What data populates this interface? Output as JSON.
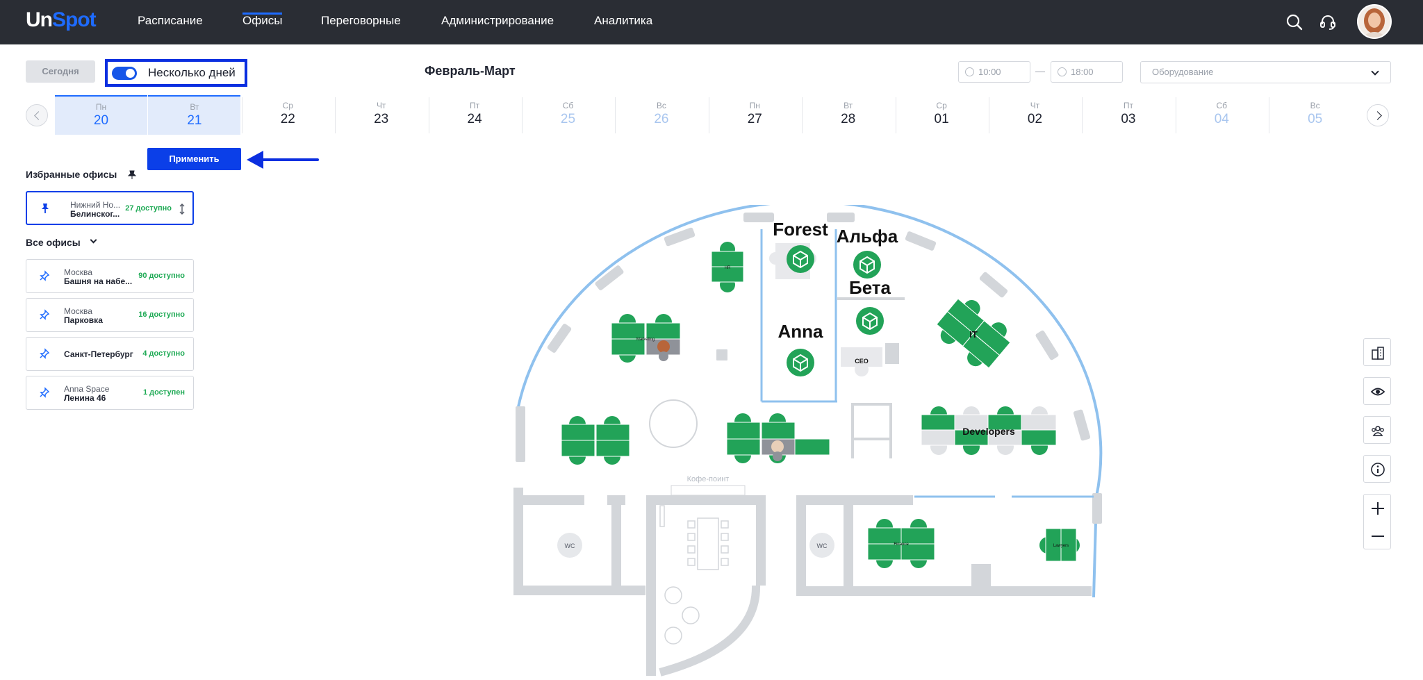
{
  "header": {
    "logo_un": "Un",
    "logo_spot": "Spot",
    "nav": [
      "Расписание",
      "Офисы",
      "Переговорные",
      "Администрирование",
      "Аналитика"
    ],
    "active_nav": "Офисы"
  },
  "toolbar": {
    "today_label": "Сегодня",
    "multi_days_label": "Несколько дней",
    "multi_days_enabled": true,
    "period_title": "Февраль-Март",
    "time_from": "10:00",
    "time_dash": "—",
    "time_to": "18:00",
    "equipment_placeholder": "Оборудование"
  },
  "calendar": {
    "days": [
      {
        "dow": "Пн",
        "num": "20",
        "selected": true,
        "weekend": false
      },
      {
        "dow": "Вт",
        "num": "21",
        "selected": true,
        "weekend": false
      },
      {
        "dow": "Ср",
        "num": "22",
        "selected": false,
        "weekend": false
      },
      {
        "dow": "Чт",
        "num": "23",
        "selected": false,
        "weekend": false
      },
      {
        "dow": "Пт",
        "num": "24",
        "selected": false,
        "weekend": false
      },
      {
        "dow": "Сб",
        "num": "25",
        "selected": false,
        "weekend": true
      },
      {
        "dow": "Вс",
        "num": "26",
        "selected": false,
        "weekend": true
      },
      {
        "dow": "Пн",
        "num": "27",
        "selected": false,
        "weekend": false
      },
      {
        "dow": "Вт",
        "num": "28",
        "selected": false,
        "weekend": false
      },
      {
        "dow": "Ср",
        "num": "01",
        "selected": false,
        "weekend": false
      },
      {
        "dow": "Чт",
        "num": "02",
        "selected": false,
        "weekend": false
      },
      {
        "dow": "Пт",
        "num": "03",
        "selected": false,
        "weekend": false
      },
      {
        "dow": "Сб",
        "num": "04",
        "selected": false,
        "weekend": true
      },
      {
        "dow": "Вс",
        "num": "05",
        "selected": false,
        "weekend": true
      }
    ]
  },
  "apply_label": "Применить",
  "favorites": {
    "title": "Избранные офисы",
    "items": [
      {
        "city": "Нижний Но...",
        "addr": "Белинског...",
        "avail": "27 доступно"
      }
    ]
  },
  "all_offices": {
    "title": "Все офисы",
    "items": [
      {
        "city": "Москва",
        "addr": "Башня на набе...",
        "avail": "90 доступно"
      },
      {
        "city": "Москва",
        "addr": "Парковка",
        "avail": "16 доступно"
      },
      {
        "city": "",
        "addr": "Санкт-Петербург",
        "avail": "4 доступно"
      },
      {
        "city": "Anna Space",
        "addr": "Ленина 46",
        "avail": "1 доступен"
      }
    ]
  },
  "map": {
    "rooms": {
      "forest": "Forest",
      "alpha": "Альфа",
      "beta": "Бета",
      "anna": "Anna",
      "it": "IT",
      "developers": "Developers",
      "ceo": "CEO",
      "coffee": "Кофе-поинт",
      "wc1": "WC",
      "wc2": "WC",
      "marketing": "Marketing",
      "hr": "HR",
      "finance": "Finance",
      "lawyers": "Lawyers"
    }
  },
  "colors": {
    "accent": "#1e6bff",
    "desk_green": "#22a358",
    "highlight": "#0b2fe0",
    "wall": "#d3d6da",
    "glass": "#8fc1ee"
  }
}
